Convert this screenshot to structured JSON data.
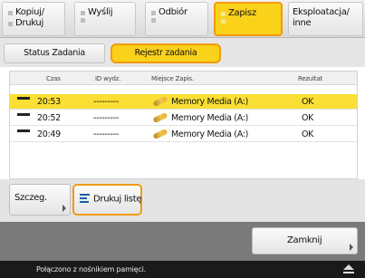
{
  "top_tabs": [
    {
      "line1": "Kopiuj/",
      "line2": "Drukuj"
    },
    {
      "line1": "Wyślij",
      "line2": ""
    },
    {
      "line1": "Odbiór",
      "line2": ""
    },
    {
      "line1": "Zapisz",
      "line2": ""
    },
    {
      "line1": "Eksploatacja/",
      "line2": "inne"
    }
  ],
  "sub_tabs": {
    "status": "Status Zadania",
    "log": "Rejestr zadania"
  },
  "table": {
    "headers": {
      "time": "Czas",
      "id": "ID wydz.",
      "location": "Miejsce Zapis.",
      "result": "Rezultat"
    },
    "rows": [
      {
        "time": "20:53",
        "id": "---------",
        "location": "Memory Media (A:)",
        "result": "OK",
        "selected": true
      },
      {
        "time": "20:52",
        "id": "---------",
        "location": "Memory Media (A:)",
        "result": "OK",
        "selected": false
      },
      {
        "time": "20:49",
        "id": "---------",
        "location": "Memory Media (A:)",
        "result": "OK",
        "selected": false
      }
    ]
  },
  "buttons": {
    "details": "Szczeg.",
    "print_list": "Drukuj listę",
    "close": "Zamknij"
  },
  "status_bar": {
    "message": "Połączono z nośnikiem pamięci."
  },
  "colors": {
    "highlight": "#fbd21a",
    "highlight_border": "#f29a12",
    "selected_row": "#fbdf34",
    "icon_blue": "#1a5ea8"
  }
}
